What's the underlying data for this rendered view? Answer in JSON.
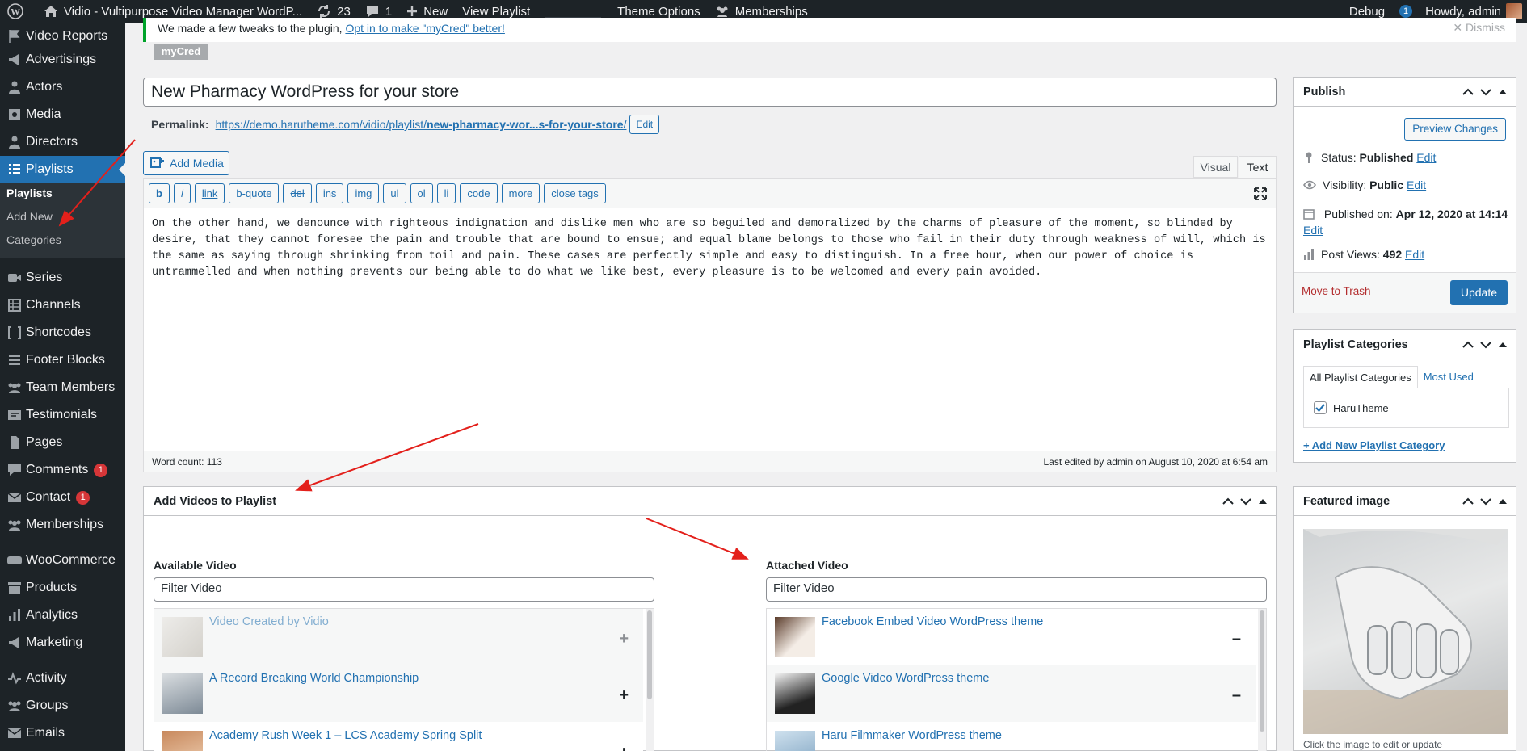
{
  "adminbar": {
    "site_title": "Vidio - Vultipurpose Video Manager WordP...",
    "updates_count": "23",
    "comments_count": "1",
    "new_label": "New",
    "view_label": "View Playlist",
    "theme_options": "Theme Options",
    "memberships": "Memberships",
    "debug": "Debug",
    "debug_count": "1",
    "howdy": "Howdy, admin"
  },
  "sidebar": {
    "items": [
      {
        "label": "Video Reports",
        "icon": "flag-icon"
      },
      {
        "label": "Advertisings",
        "icon": "megaphone-icon"
      },
      {
        "label": "Actors",
        "icon": "user-icon"
      },
      {
        "label": "Media",
        "icon": "media-icon"
      },
      {
        "label": "Directors",
        "icon": "user-icon"
      },
      {
        "label": "Playlists",
        "icon": "list-icon"
      },
      {
        "label": "Series",
        "icon": "video-icon"
      },
      {
        "label": "Channels",
        "icon": "table-icon"
      },
      {
        "label": "Shortcodes",
        "icon": "shortcode-icon"
      },
      {
        "label": "Footer Blocks",
        "icon": "menu-icon"
      },
      {
        "label": "Team Members",
        "icon": "groups-icon"
      },
      {
        "label": "Testimonials",
        "icon": "testimonial-icon"
      },
      {
        "label": "Pages",
        "icon": "page-icon"
      },
      {
        "label": "Comments",
        "icon": "comment-icon",
        "badge": "1"
      },
      {
        "label": "Contact",
        "icon": "mail-icon",
        "badge": "1"
      },
      {
        "label": "Memberships",
        "icon": "groups-icon"
      },
      {
        "label": "WooCommerce",
        "icon": "woo-icon"
      },
      {
        "label": "Products",
        "icon": "archive-icon"
      },
      {
        "label": "Analytics",
        "icon": "chart-icon"
      },
      {
        "label": "Marketing",
        "icon": "megaphone-icon"
      },
      {
        "label": "Activity",
        "icon": "activity-icon"
      },
      {
        "label": "Groups",
        "icon": "groups-icon"
      },
      {
        "label": "Emails",
        "icon": "mail-icon"
      }
    ],
    "submenu": [
      "Playlists",
      "Add New",
      "Categories"
    ]
  },
  "notice": {
    "text": "We made a few tweaks to the plugin,",
    "link": "Opt in to make \"myCred\" better!",
    "dismiss": "Dismiss",
    "tag": "myCred"
  },
  "post": {
    "title": "New Pharmacy WordPress for your store",
    "permalink_label": "Permalink:",
    "permalink_base": "https://demo.harutheme.com/vidio/playlist/",
    "permalink_slug": "new-pharmacy-wor...s-for-your-store",
    "permalink_end": "/",
    "edit_label": "Edit"
  },
  "editor": {
    "add_media": "Add Media",
    "tab_visual": "Visual",
    "tab_text": "Text",
    "quicktags": [
      "b",
      "i",
      "link",
      "b-quote",
      "del",
      "ins",
      "img",
      "ul",
      "ol",
      "li",
      "code",
      "more",
      "close tags"
    ],
    "content": "On the other hand, we denounce with righteous indignation and dislike men who are so beguiled and demoralized by the charms of pleasure of the moment, so blinded by desire, that they cannot foresee the pain and trouble that are bound to ensue; and equal blame belongs to those who fail in their duty through weakness of will, which is the same as saying through shrinking from toil and pain. These cases are perfectly simple and easy to distinguish. In a free hour, when our power of choice is untrammelled and when nothing prevents our being able to do what we like best, every pleasure is to be welcomed and every pain avoided.",
    "word_count": "Word count: 113",
    "last_edited": "Last edited by admin on August 10, 2020 at 6:54 am"
  },
  "add_videos": {
    "title": "Add Videos to Playlist",
    "available_label": "Available Video",
    "attached_label": "Attached Video",
    "filter_placeholder": "Filter Video",
    "available": [
      {
        "title": "Video Created by Vidio",
        "action": "+"
      },
      {
        "title": "A Record Breaking World Championship",
        "action": "+"
      },
      {
        "title": "Academy Rush Week 1 – LCS Academy Spring Split",
        "action": "+"
      }
    ],
    "attached": [
      {
        "title": "Facebook Embed Video WordPress theme",
        "action": "–"
      },
      {
        "title": "Google Video WordPress theme",
        "action": "–"
      },
      {
        "title": "Haru Filmmaker WordPress theme",
        "action": "–"
      }
    ]
  },
  "publish": {
    "title": "Publish",
    "preview": "Preview Changes",
    "status_label": "Status:",
    "status_value": "Published",
    "visibility_label": "Visibility:",
    "visibility_value": "Public",
    "published_label": "Published on:",
    "published_value": "Apr 12, 2020 at 14:14",
    "views_label": "Post Views:",
    "views_value": "492",
    "edit": "Edit",
    "trash": "Move to Trash",
    "update": "Update"
  },
  "categories": {
    "title": "Playlist Categories",
    "tab_all": "All Playlist Categories",
    "tab_used": "Most Used",
    "items": [
      {
        "label": "HaruTheme",
        "checked": true
      }
    ],
    "add_new": "+ Add New Playlist Category"
  },
  "featured": {
    "title": "Featured image",
    "caption": "Click the image to edit or update"
  },
  "colors": {
    "accent": "#2271b1",
    "sidebar": "#1d2327",
    "annotation": "#e3201b"
  }
}
